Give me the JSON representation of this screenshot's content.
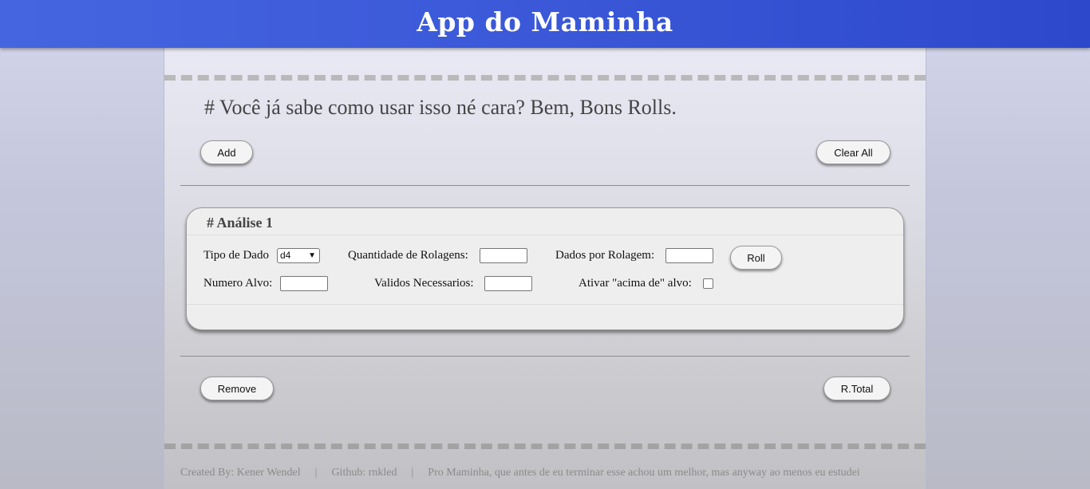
{
  "header": {
    "title": "App do Maminha"
  },
  "intro": {
    "text": "# Você já sabe como usar isso né cara? Bem, Bons Rolls."
  },
  "top_actions": {
    "add_label": "Add",
    "clear_all_label": "Clear All"
  },
  "analysis": {
    "title": "# Análise 1",
    "dice_type_label": "Tipo de Dado",
    "dice_type_value": "d4",
    "roll_count_label": "Quantidade de Rolagens:",
    "roll_count_value": "",
    "dice_per_roll_label": "Dados por Rolagem:",
    "dice_per_roll_value": "",
    "roll_label": "Roll",
    "target_label": "Numero Alvo:",
    "target_value": "",
    "required_label": "Validos Necessarios:",
    "required_value": "",
    "above_target_label": "Ativar \"acima de\" alvo:",
    "above_target_checked": false
  },
  "bottom_actions": {
    "remove_label": "Remove",
    "rtotal_label": "R.Total"
  },
  "footer": {
    "created_by": "Created By: Kener Wendel",
    "separator": "|",
    "github": "Github: rnkled",
    "note": "Pro Maminha, que antes de eu terminar esse achou um melhor, mas anyway ao menos eu estudei"
  }
}
